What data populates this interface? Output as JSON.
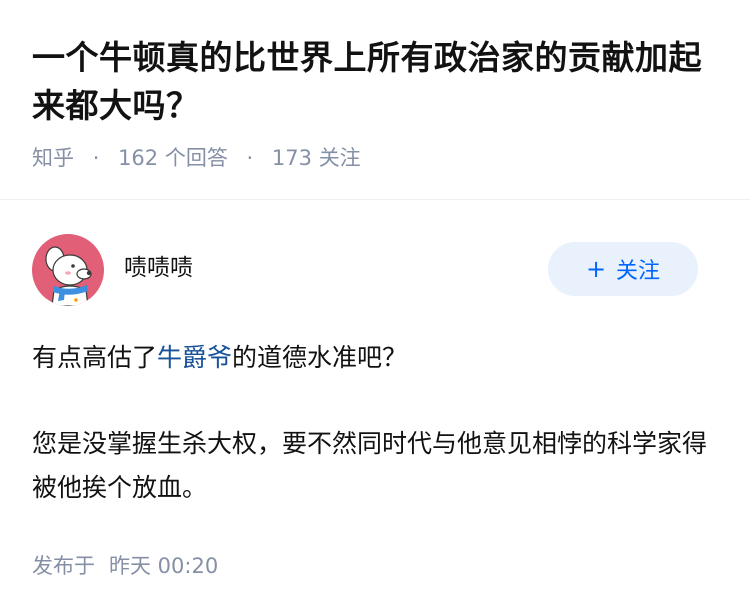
{
  "question": {
    "title": "一个牛顿真的比世界上所有政治家的贡献加起来都大吗？",
    "source": "知乎",
    "answer_count": "162",
    "answer_label": "个回答",
    "follower_count": "173",
    "follower_label": "关注",
    "separator": "·"
  },
  "author": {
    "name": "啧啧啧",
    "avatar_icon": "cartoon-dog-avatar",
    "follow_icon": "plus-icon",
    "follow_plus": "+",
    "follow_label": "关注"
  },
  "answer": {
    "p1_before": "有点高估了",
    "p1_mention": "牛爵爷",
    "p1_after": "的道德水准吧？",
    "p2": "您是没掌握生杀大权，要不然同时代与他意见相悖的科学家得被他挨个放血。"
  },
  "publish": {
    "label": "发布于",
    "time": "昨天 00:20"
  },
  "colors": {
    "link": "#175199",
    "accent": "#0066ff",
    "meta": "#8590a6",
    "follow_bg": "#e8f1fc",
    "avatar_bg": "#e15f77"
  }
}
